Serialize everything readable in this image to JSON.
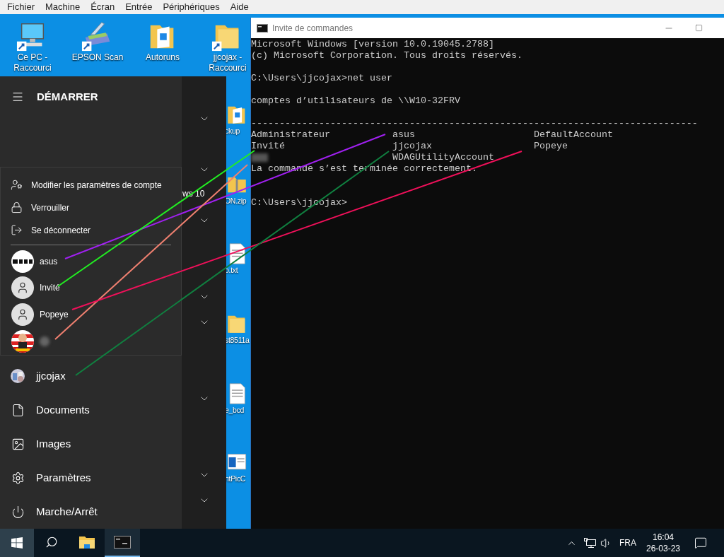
{
  "menu_bar": [
    "Fichier",
    "Machine",
    "Écran",
    "Entrée",
    "Périphériques",
    "Aide"
  ],
  "desktop_icons": [
    {
      "kind": "computer",
      "label": "Ce PC - Raccourci",
      "shortcut": true
    },
    {
      "kind": "scanner",
      "label": "EPSON Scan",
      "shortcut": true
    },
    {
      "kind": "folder-doc",
      "label": "Autoruns",
      "shortcut": false
    },
    {
      "kind": "folder",
      "label": "jjcojax - Raccourci",
      "shortcut": true
    }
  ],
  "desktop_column_icons": [
    {
      "kind": "folder-doc",
      "label": "ckup"
    },
    {
      "kind": "zip",
      "label": "ON.zip"
    },
    {
      "kind": "text",
      "label": "o.txt"
    },
    {
      "kind": "folder",
      "label": "st8511a"
    },
    {
      "kind": "text",
      "label": "e_bcd"
    },
    {
      "kind": "app",
      "label": "ntPicC"
    }
  ],
  "start_menu": {
    "title": "DÉMARRER",
    "group_label": "ws 10",
    "account_menu": {
      "actions": [
        {
          "label": "Modifier les paramètres de compte"
        },
        {
          "label": "Verrouiller"
        },
        {
          "label": "Se déconnecter"
        }
      ],
      "users": [
        {
          "kind": "logo",
          "name": "asus"
        },
        {
          "kind": "generic",
          "name": "Invité"
        },
        {
          "kind": "generic",
          "name": "Popeye"
        },
        {
          "kind": "picture",
          "name_blurred": true
        }
      ]
    },
    "items": [
      {
        "label": "jjcojax"
      },
      {
        "label": "Documents"
      },
      {
        "label": "Images"
      },
      {
        "label": "Paramètres"
      },
      {
        "label": "Marche/Arrêt"
      }
    ]
  },
  "console_window": {
    "title": "Invite de commandes",
    "lines": [
      {
        "kind": "text",
        "text": "Microsoft Windows [version 10.0.19045.2788]"
      },
      {
        "kind": "text",
        "text": "(c) Microsoft Corporation. Tous droits réservés."
      },
      {
        "kind": "blank"
      },
      {
        "kind": "text",
        "text": "C:\\Users\\jjcojax>net user"
      },
      {
        "kind": "blank"
      },
      {
        "kind": "text",
        "text": "comptes d’utilisateurs de \\\\W10-32FRV"
      },
      {
        "kind": "blank"
      },
      {
        "kind": "text",
        "text": "-------------------------------------------------------------------------------"
      },
      {
        "kind": "accounts",
        "cells": [
          {
            "kind": "name",
            "text": "Administrateur"
          },
          {
            "kind": "name",
            "text": "asus"
          },
          {
            "kind": "name",
            "text": "DefaultAccount"
          },
          {
            "kind": "name",
            "text": "Invité"
          },
          {
            "kind": "name",
            "text": "jjcojax"
          },
          {
            "kind": "name",
            "text": "Popeye"
          },
          {
            "kind": "redacted"
          },
          {
            "kind": "name",
            "text": "WDAGUtilityAccount"
          }
        ]
      },
      {
        "kind": "text",
        "text": "La commande s’est terminée correctement."
      },
      {
        "kind": "blank"
      },
      {
        "kind": "blank"
      },
      {
        "kind": "text",
        "text": "C:\\Users\\jjcojax>"
      }
    ]
  },
  "taskbar": {
    "apps": [
      {
        "selected": false
      },
      {
        "selected": false
      },
      {
        "selected": true
      }
    ],
    "tray": {
      "language": "FRA",
      "time": "16:04",
      "date": "26-03-23"
    }
  },
  "annotations": [
    {
      "color": "#a020f0"
    },
    {
      "color": "#22ee22"
    },
    {
      "color": "#f08070"
    },
    {
      "color": "#f0105a"
    },
    {
      "color": "#108040"
    }
  ]
}
